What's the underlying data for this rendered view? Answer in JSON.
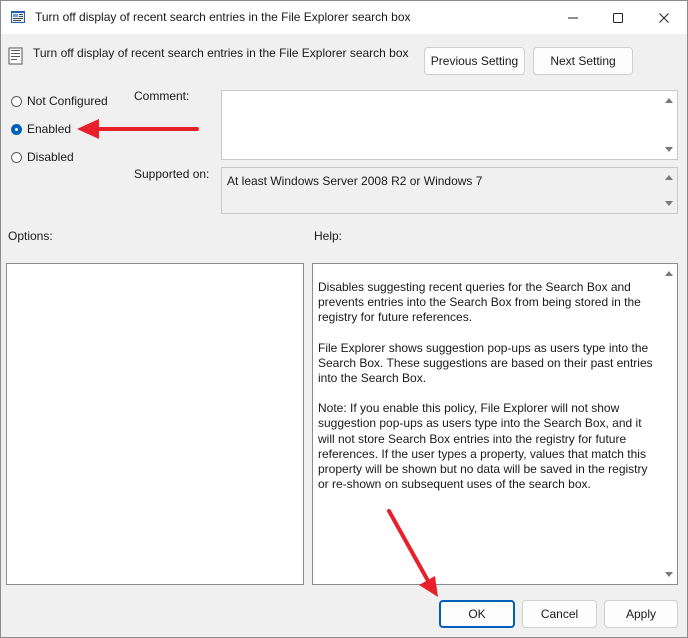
{
  "window": {
    "title": "Turn off display of recent search entries in the File Explorer search box"
  },
  "header": {
    "title": "Turn off display of recent search entries in the File Explorer search box",
    "previous_label": "Previous Setting",
    "next_label": "Next Setting"
  },
  "state": {
    "options": [
      {
        "label": "Not Configured",
        "checked": false
      },
      {
        "label": "Enabled",
        "checked": true
      },
      {
        "label": "Disabled",
        "checked": false
      }
    ]
  },
  "comment": {
    "label": "Comment:",
    "value": ""
  },
  "supported": {
    "label": "Supported on:",
    "value": "At least Windows Server 2008 R2 or Windows 7"
  },
  "options_pane": {
    "label": "Options:"
  },
  "help": {
    "label": "Help:",
    "paragraphs": [
      "Disables suggesting recent queries for the Search Box and prevents entries into the Search Box from being stored in the registry for future references.",
      "File Explorer shows suggestion pop-ups as users type into the Search Box.  These suggestions are based on their past entries into the Search Box.",
      "Note: If you enable this policy, File Explorer will not show suggestion pop-ups as users type into the Search Box, and it will not store Search Box entries into the registry for future references.  If the user types a property, values that match this property will be shown but no data will be saved in the registry or re-shown on subsequent uses of the search box."
    ]
  },
  "footer": {
    "ok_label": "OK",
    "cancel_label": "Cancel",
    "apply_label": "Apply"
  },
  "annotations": {
    "arrow_color": "#e8202a"
  },
  "colors": {
    "accent": "#005fb8",
    "window_bg": "#f0f0f0"
  },
  "icons": [
    "policy-app-icon",
    "minimize-icon",
    "maximize-icon",
    "close-icon",
    "policy-setting-icon"
  ]
}
